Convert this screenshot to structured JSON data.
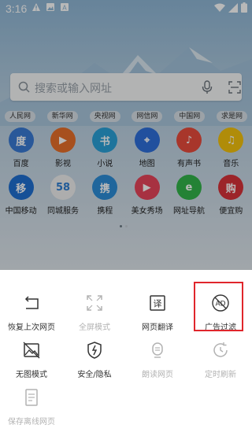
{
  "status_bar": {
    "time": "3:16",
    "notification_icons": [
      "alert-icon",
      "image-icon",
      "letter-a-icon"
    ]
  },
  "search": {
    "placeholder": "搜索或输入网址"
  },
  "site_links": [
    "人民网",
    "新华网",
    "央视网",
    "网信网",
    "中国网",
    "求是网"
  ],
  "apps_row1": [
    {
      "label": "百度",
      "color": "#3a7bd5",
      "glyph": "度"
    },
    {
      "label": "影视",
      "color": "#e8702a",
      "glyph": "▶"
    },
    {
      "label": "小说",
      "color": "#2aa1d9",
      "glyph": "书"
    },
    {
      "label": "地图",
      "color": "#2e6fdc",
      "glyph": "⌖"
    },
    {
      "label": "有声书",
      "color": "#e94b3c",
      "glyph": "♪"
    },
    {
      "label": "音乐",
      "color": "#f4c20d",
      "glyph": "♫"
    }
  ],
  "apps_row2": [
    {
      "label": "中国移动",
      "color": "#1f6fd1",
      "glyph": "移"
    },
    {
      "label": "同城服务",
      "color": "#f0f0f0",
      "glyph": "58"
    },
    {
      "label": "携程",
      "color": "#2d8ed8",
      "glyph": "携"
    },
    {
      "label": "美女秀场",
      "color": "#e8455a",
      "glyph": "▶"
    },
    {
      "label": "网址导航",
      "color": "#32b44a",
      "glyph": "e"
    },
    {
      "label": "便宜购",
      "color": "#d8323a",
      "glyph": "购"
    }
  ],
  "menu": {
    "restore_last": "恢复上次网页",
    "fullscreen": "全屏模式",
    "translate": "网页翻译",
    "ad_filter": "广告过滤",
    "no_image": "无图模式",
    "security": "安全/隐私",
    "read_aloud": "朗读网页",
    "auto_refresh": "定时刷新",
    "save_offline": "保存离线网页"
  },
  "colors": {
    "highlight": "#e0262c",
    "disabled": "#b2b2b2"
  }
}
